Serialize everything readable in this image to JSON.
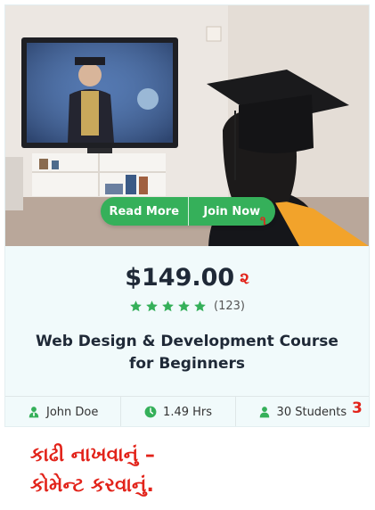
{
  "course": {
    "image_alt": "Graduate watching graduation ceremony on TV",
    "read_more_label": "Read More",
    "join_now_label": "Join Now",
    "price": "$149.00",
    "rating_stars": 5,
    "rating_count": "(123)",
    "title_line1": "Web Design & Development Course",
    "title_line2": "for Beginners",
    "instructor": "John Doe",
    "duration": "1.49 Hrs",
    "students": "30 Students"
  },
  "annotations": {
    "mark_1": "૧",
    "mark_2": "૨",
    "mark_3": "3",
    "note_line1": "કાઢી નાખવાનું –",
    "note_line2": "કોમેન્ટ કરવાનું."
  },
  "colors": {
    "accent_green": "#35b05a",
    "annotation_red": "#e2231a",
    "card_bg": "#f1fafb"
  }
}
